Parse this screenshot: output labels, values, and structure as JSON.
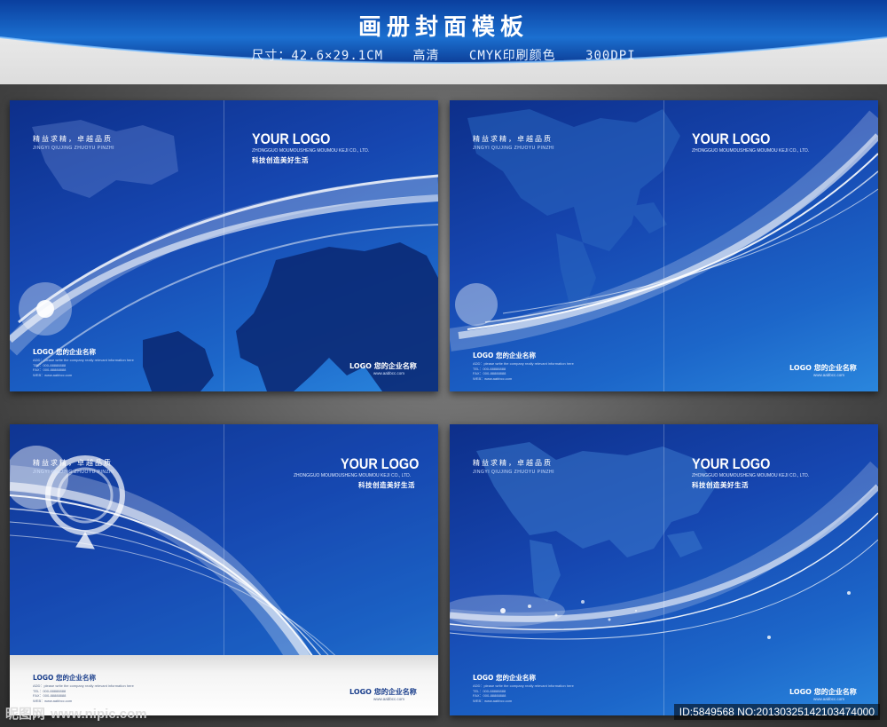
{
  "header": {
    "title": "画册封面模板",
    "spec_size": "尺寸：42.6×29.1CM",
    "spec_quality": "高清",
    "spec_color": "CMYK印刷颜色",
    "spec_dpi": "300DPI"
  },
  "brochure": {
    "slogan": "精益求精，卓越品质",
    "slogan_pinyin": "JINGYI QIUJING    ZHUOYU PINZHI",
    "logo": "YOUR LOGO",
    "company_en": "ZHONGGUO MOUMOUSHENG MOUMOU KEJI CO., LTD.",
    "tagline": "科技创造美好生活",
    "back_logo": "LOGO 您的企业名称",
    "back_info_1": "ADD：please write the company really relevant information here",
    "back_info_2": "TEL：000-88888888",
    "back_info_3": "FAX：000-88888888",
    "back_info_4": "WEB：www.aabbcc.com",
    "front_company": "LOGO 您的企业名称",
    "front_url": "www.aabbcc.com"
  },
  "watermark": {
    "site_name": "昵图网",
    "site_url": "www.nipic.com",
    "image_id": "ID:5849568 NO:20130325142103474000"
  },
  "colors": {
    "deep_blue": "#0d2f8a",
    "mid_blue": "#1c66c9",
    "light_blue": "#2a86dd"
  }
}
